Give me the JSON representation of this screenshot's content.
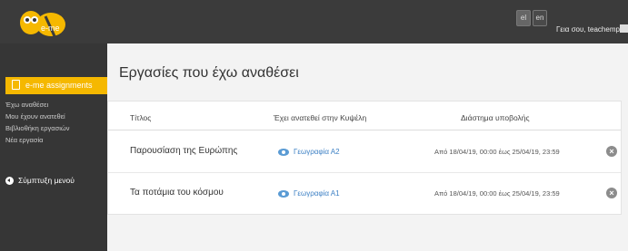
{
  "header": {
    "lang_el": "el",
    "lang_en": "en",
    "greeting": "Γεια σου, teachemp",
    "logo_text": "e-me"
  },
  "sidebar": {
    "section_label": "e-me assignments",
    "links": [
      "Έχω αναθέσει",
      "Μου έχουν ανατεθεί",
      "Βιβλιοθήκη εργασιών",
      "Νέα εργασία"
    ],
    "collapse_label": "Σύμπτυξη μενού"
  },
  "main": {
    "title": "Εργασίες που έχω αναθέσει",
    "columns": [
      "Τίτλος",
      "Έχει ανατεθεί στην Κυψέλη",
      "Διάστημα υποβολής"
    ],
    "rows": [
      {
        "title": "Παρουσίαση της Ευρώπης",
        "class": "Γεωγραφία Α2",
        "period": "Από 18/04/19, 00:00 έως 25/04/19, 23:59"
      },
      {
        "title": "Τα ποτάμια του κόσμου",
        "class": "Γεωγραφία Α1",
        "period": "Από 18/04/19, 00:00 έως 25/04/19, 23:59"
      }
    ]
  },
  "colors": {
    "accent": "#f5b800",
    "link": "#3b7fc4",
    "topbar": "#3b3b3b",
    "sidebar": "#363636"
  }
}
